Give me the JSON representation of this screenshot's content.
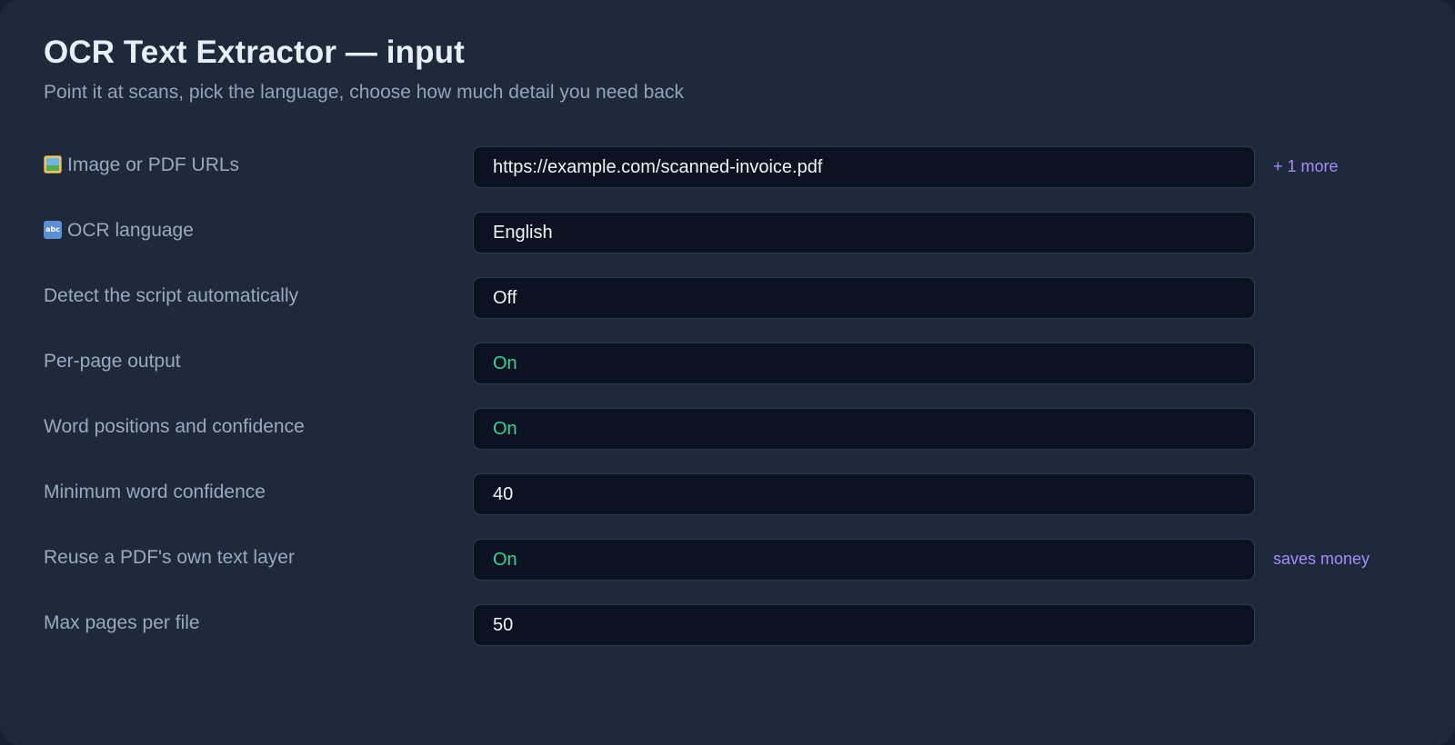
{
  "header": {
    "title": "OCR Text Extractor — input",
    "subtitle": "Point it at scans, pick the language, choose how much detail you need back"
  },
  "fields": [
    {
      "label": "Image or PDF URLs",
      "icon": "framed-picture-icon",
      "value": "https://example.com/scanned-invoice.pdf",
      "note": "+ 1 more"
    },
    {
      "label": "OCR language",
      "icon": "abc-input-icon",
      "value": "English"
    },
    {
      "label": "Detect the script automatically",
      "value": "Off"
    },
    {
      "label": "Per-page output",
      "value": "On"
    },
    {
      "label": "Word positions and confidence",
      "value": "On"
    },
    {
      "label": "Minimum word confidence",
      "value": "40"
    },
    {
      "label": "Reuse a PDF's own text layer",
      "value": "On",
      "note": "saves money"
    },
    {
      "label": "Max pages per file",
      "value": "50"
    }
  ],
  "colors": {
    "background": "#1e293b",
    "field_background": "#0b1320",
    "on_value": "#34d399",
    "note": "#a78bfa",
    "label": "#9aa9bd"
  }
}
